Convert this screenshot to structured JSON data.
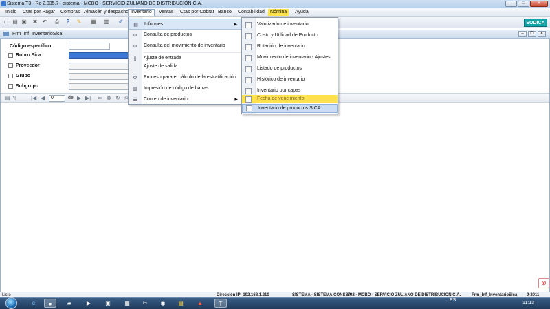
{
  "window": {
    "title": "Sistema T3 - Rc 2.035.7 - sistema - MCBO - SERVICIO ZULIANO DE DISTRIBUCIÓN C.A."
  },
  "menubar": [
    "Inicio",
    "Ctas por Pagar",
    "Compras",
    "Almacén y despacho",
    "Inventario",
    "Ventas",
    "Ctas por Cobrar",
    "Banco",
    "Contabilidad",
    "Nómina",
    "Ayuda"
  ],
  "badge": "SODICA",
  "child": {
    "title": "Frm_Inf_InventarioSica"
  },
  "filters": {
    "codigo_label": "Código específico:",
    "rubro_label": "Rubro Sica",
    "proveedor_label": "Proveedor",
    "grupo_label": "Grupo",
    "subgrupo_label": "Subgrupo"
  },
  "nav": {
    "page": "0",
    "de": "de"
  },
  "inventario_menu": [
    {
      "label": "Informes",
      "submenu": true
    },
    {
      "label": "Consulta de productos"
    },
    {
      "label": "Consulta del movimiento de inventario"
    },
    {
      "label": "Ajuste de entrada"
    },
    {
      "label": "Ajuste de salida"
    },
    {
      "label": "Proceso para el cálculo de la estratificación"
    },
    {
      "label": "Impresión de código de barras"
    },
    {
      "label": "Conteo de inventario",
      "submenu": true
    }
  ],
  "informes_menu": [
    "Valorizado de inventario",
    "Costo y Utilidad de Producto",
    "Rotación de inventario",
    "Movimiento de inventario - Ajustes",
    "Listado de productos",
    "Histórico de inventario",
    "Inventario por capas",
    "Fecha de vencimiento",
    "Inventario de productos SICA"
  ],
  "statusbar": {
    "left": "Listo",
    "ip": "Dirección IP: 192.168.1.210",
    "user": "SISTEMA - SISTEMA.CONSSA",
    "company": "S02 - MCBO - SERVICIO ZULIANO DE DISTRIBUCIÓN C.A.",
    "form": "Frm_Inf_InventarioSica",
    "period": "9-2011"
  },
  "tray": {
    "lang": "ES",
    "time": "11:13"
  },
  "colors": {
    "highlight": "#ffe24d",
    "accent": "#11a3a8"
  }
}
